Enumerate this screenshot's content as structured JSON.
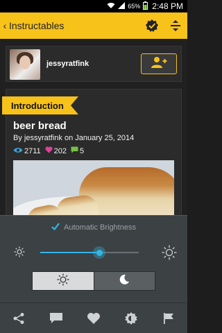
{
  "status_bar": {
    "battery": "65%",
    "time": "2:48 PM"
  },
  "action_bar": {
    "back_glyph": "‹",
    "title": "Instructables"
  },
  "author": {
    "name": "jessyratfink"
  },
  "project": {
    "section_label": "Introduction",
    "title": "beer bread",
    "byline": "By jessyratfink on January 25, 2014",
    "views": "2711",
    "favorites": "202",
    "comments": "5"
  },
  "brightness": {
    "auto_label": "Automatic Brightness",
    "auto_checked": true,
    "level": 0.6
  },
  "colors": {
    "accent": "#f7c21a",
    "slider": "#33b5e5",
    "favorite": "#e0409a",
    "views": "#3aa0d8",
    "comments": "#77c043"
  },
  "icons": [
    "back-icon",
    "wifi-icon",
    "signal-icon",
    "battery-icon",
    "patch-icon",
    "sort-icon",
    "add-follow-icon",
    "views-icon",
    "heart-icon",
    "comment-icon",
    "check-icon",
    "sun-small-icon",
    "sun-large-icon",
    "sun-day-icon",
    "moon-icon",
    "share-icon",
    "chat-icon",
    "favorite-icon",
    "brightness-icon",
    "flag-icon"
  ]
}
